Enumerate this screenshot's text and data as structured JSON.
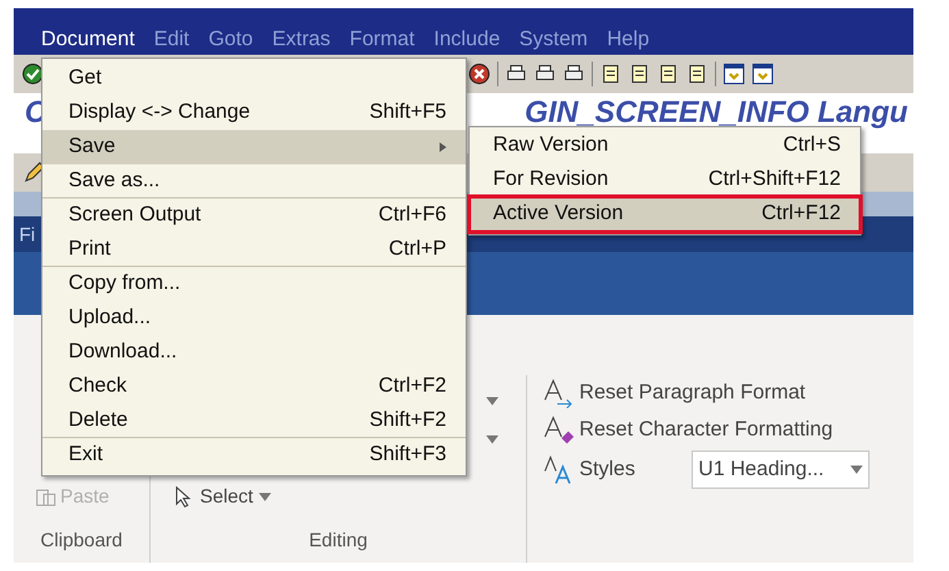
{
  "menubar": [
    {
      "label": "Document",
      "selected": true
    },
    {
      "label": "Edit",
      "selected": false
    },
    {
      "label": "Goto",
      "selected": false
    },
    {
      "label": "Extras",
      "selected": false
    },
    {
      "label": "Format",
      "selected": false
    },
    {
      "label": "Include",
      "selected": false
    },
    {
      "label": "System",
      "selected": false
    },
    {
      "label": "Help",
      "selected": false
    }
  ],
  "screen_title": {
    "left": "C",
    "right": "GIN_SCREEN_INFO Langu"
  },
  "document_menu": [
    {
      "label": "Get",
      "selected": false,
      "submenu": false,
      "separator_after": false
    },
    {
      "label": "Display <-> Change",
      "shortcut": "Shift+F5",
      "selected": false,
      "submenu": false,
      "separator_after": false
    },
    {
      "label": "Save",
      "selected": true,
      "submenu": true,
      "separator_after": false
    },
    {
      "label": "Save as...",
      "selected": false,
      "submenu": false,
      "separator_after": true
    },
    {
      "label": "Screen Output",
      "shortcut": "Ctrl+F6",
      "selected": false,
      "submenu": false,
      "separator_after": false
    },
    {
      "label": "Print",
      "shortcut": "Ctrl+P",
      "selected": false,
      "submenu": false,
      "separator_after": true
    },
    {
      "label": "Copy from...",
      "selected": false,
      "submenu": false,
      "separator_after": false
    },
    {
      "label": "Upload...",
      "selected": false,
      "submenu": false,
      "separator_after": false
    },
    {
      "label": "Download...",
      "selected": false,
      "submenu": false,
      "separator_after": false
    },
    {
      "label": "Check",
      "shortcut": "Ctrl+F2",
      "selected": false,
      "submenu": false,
      "separator_after": false
    },
    {
      "label": "Delete",
      "shortcut": "Shift+F2",
      "selected": false,
      "submenu": false,
      "separator_after": true
    },
    {
      "label": "Exit",
      "shortcut": "Shift+F3",
      "selected": false,
      "submenu": false,
      "separator_after": false
    }
  ],
  "save_submenu": [
    {
      "label": "Raw Version",
      "shortcut": "Ctrl+S",
      "selected": false
    },
    {
      "label": "For Revision",
      "shortcut": "Ctrl+Shift+F12",
      "selected": false
    },
    {
      "label": "Active Version",
      "shortcut": "Ctrl+F12",
      "selected": true
    }
  ],
  "word_window": {
    "title": "Fi",
    "clipboard": {
      "paste": "Paste",
      "label": "Clipboard"
    },
    "editing": {
      "select": "Select",
      "label": "Editing"
    },
    "styles": {
      "reset_paragraph": "Reset Paragraph Format",
      "reset_character": "Reset Character Formatting",
      "styles": "Styles",
      "style_value": "U1 Heading..."
    }
  }
}
